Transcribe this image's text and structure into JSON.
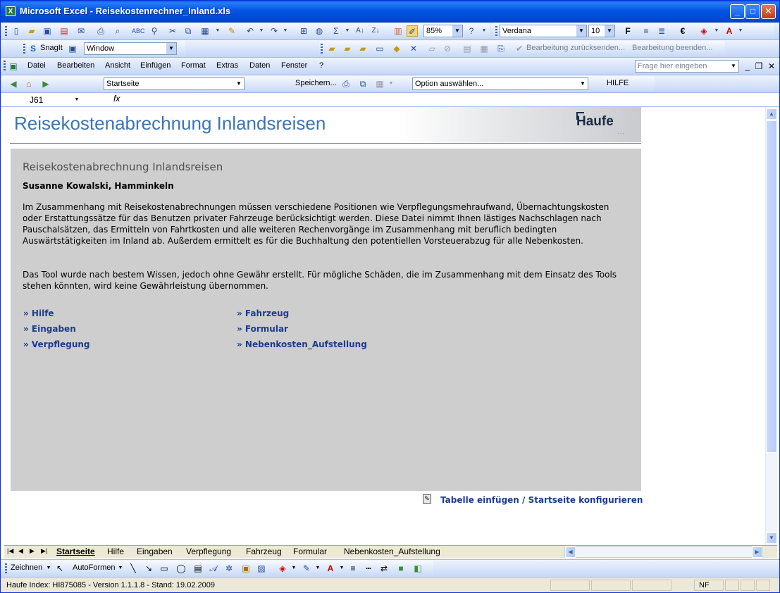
{
  "window": {
    "title": "Microsoft Excel - Reisekostenrechner_Inland.xls",
    "app_icon": "excel-icon"
  },
  "toolbar_standard": {
    "zoom": "85%",
    "font_name": "Verdana",
    "font_size": "10",
    "bold_label": "F",
    "euro_label": "€"
  },
  "toolbar_snagit": {
    "snagit_label": "SnagIt",
    "capture_mode": "Window"
  },
  "toolbar_review": {
    "send_back_label": "Bearbeitung zurücksenden...",
    "end_review_label": "Bearbeitung beenden..."
  },
  "menubar": {
    "items": [
      "Datei",
      "Bearbeiten",
      "Ansicht",
      "Einfügen",
      "Format",
      "Extras",
      "Daten",
      "Fenster",
      "?"
    ],
    "help_placeholder": "Frage hier eingeben"
  },
  "nav_toolbar": {
    "sheet_select": "Startseite",
    "save_label": "Speichern...",
    "option_select": "Option auswählen...",
    "help_label": "HILFE"
  },
  "formula_bar": {
    "name_box": "J61",
    "fx_label": "fx"
  },
  "sheet": {
    "banner_title": "Reisekostenabrechnung Inlandsreisen",
    "logo_text": "Haufe",
    "panel": {
      "title": "Reisekostenabrechnung Inlandsreisen",
      "person": "Susanne Kowalski, Hamminkeln",
      "paragraph1": "Im Zusammenhang mit Reisekostenabrechnungen müssen verschiedene Positionen wie Verpflegungsmehraufwand, Übernachtungskosten oder Erstattungssätze für das Benutzen privater Fahrzeuge berücksichtigt werden. Diese Datei nimmt Ihnen lästiges Nachschlagen nach Pauschalsätzen, das Ermitteln von Fahrtkosten und alle weiteren Rechenvorgänge im Zusammenhang mit beruflich bedingten Auswärtstätigkeiten im Inland ab. Außerdem ermittelt es für die Buchhaltung den potentiellen Vorsteuerabzug für alle Nebenkosten.",
      "paragraph2": "Das Tool wurde nach bestem Wissen, jedoch ohne Gewähr erstellt. Für mögliche Schäden, die im Zusammenhang mit dem Einsatz des Tools stehen könnten, wird keine Gewährleistung übernommen.",
      "links_left": [
        "» Hilfe",
        "» Eingaben",
        "» Verpflegung"
      ],
      "links_right": [
        "» Fahrzeug",
        "» Formular",
        "» Nebenkosten_Aufstellung"
      ]
    },
    "footer_link": "Tabelle einfügen / Startseite konfigurieren"
  },
  "tabs": {
    "items": [
      "Startseite",
      "Hilfe",
      "Eingaben",
      "Verpflegung",
      "Fahrzeug",
      "Formular",
      "Nebenkosten_Aufstellung"
    ],
    "active": "Startseite"
  },
  "drawing_toolbar": {
    "draw_label": "Zeichnen",
    "autoshapes_label": "AutoFormen"
  },
  "status_bar": {
    "text": "Haufe Index: HI875085 - Version 1.1.1.8 - Stand: 19.02.2009",
    "nf": "NF"
  },
  "colors": {
    "title_bar": "#0054e3",
    "banner_title": "#3b74b6",
    "panel_bg": "#cecece",
    "link": "#1c3c8c"
  }
}
